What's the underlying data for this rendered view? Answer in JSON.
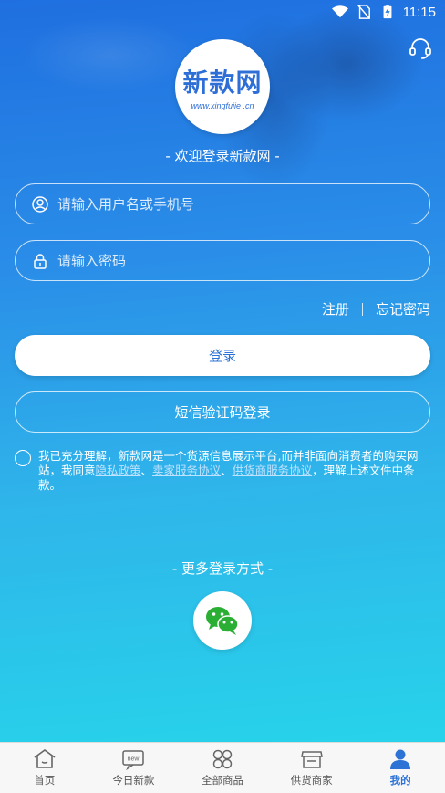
{
  "status_bar": {
    "time": "11:15"
  },
  "logo": {
    "text": "新款网",
    "url": "www.xingfujie .cn"
  },
  "welcome": "- 欢迎登录新款网 -",
  "username": {
    "placeholder": "请输入用户名或手机号",
    "value": ""
  },
  "password": {
    "placeholder": "请输入密码",
    "value": ""
  },
  "links": {
    "register": "注册",
    "forgot": "忘记密码"
  },
  "buttons": {
    "login": "登录",
    "sms_login": "短信验证码登录"
  },
  "agreement": {
    "prefix": "我已充分理解，新款网是一个货源信息展示平台,而并非面向消费者的购买网站，我同意",
    "privacy": "隐私政策",
    "sep1": "、",
    "seller": "卖家服务协议",
    "sep2": "、",
    "supplier": "供货商服务协议",
    "suffix": "，理解上述文件中条款。"
  },
  "more_login": "- 更多登录方式 -",
  "tabs": [
    {
      "label": "首页",
      "icon": "home-icon"
    },
    {
      "label": "今日新款",
      "icon": "new-icon"
    },
    {
      "label": "全部商品",
      "icon": "grid-icon"
    },
    {
      "label": "供货商家",
      "icon": "store-icon"
    },
    {
      "label": "我的",
      "icon": "user-icon",
      "active": true
    }
  ],
  "colors": {
    "accent": "#2d73d6",
    "gradient_top": "#1f6fe0",
    "gradient_bottom": "#27d3ea",
    "wechat": "#2aae34"
  }
}
